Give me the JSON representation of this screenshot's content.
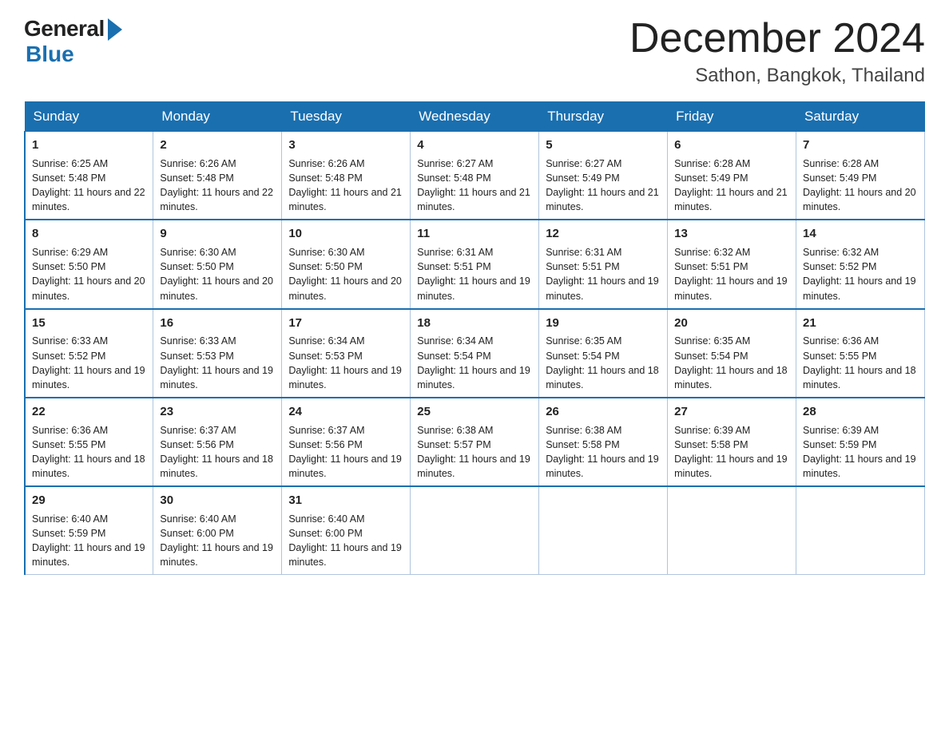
{
  "header": {
    "logo_general": "General",
    "logo_blue": "Blue",
    "title": "December 2024",
    "subtitle": "Sathon, Bangkok, Thailand"
  },
  "columns": [
    "Sunday",
    "Monday",
    "Tuesday",
    "Wednesday",
    "Thursday",
    "Friday",
    "Saturday"
  ],
  "weeks": [
    [
      {
        "day": "1",
        "sunrise": "Sunrise: 6:25 AM",
        "sunset": "Sunset: 5:48 PM",
        "daylight": "Daylight: 11 hours and 22 minutes."
      },
      {
        "day": "2",
        "sunrise": "Sunrise: 6:26 AM",
        "sunset": "Sunset: 5:48 PM",
        "daylight": "Daylight: 11 hours and 22 minutes."
      },
      {
        "day": "3",
        "sunrise": "Sunrise: 6:26 AM",
        "sunset": "Sunset: 5:48 PM",
        "daylight": "Daylight: 11 hours and 21 minutes."
      },
      {
        "day": "4",
        "sunrise": "Sunrise: 6:27 AM",
        "sunset": "Sunset: 5:48 PM",
        "daylight": "Daylight: 11 hours and 21 minutes."
      },
      {
        "day": "5",
        "sunrise": "Sunrise: 6:27 AM",
        "sunset": "Sunset: 5:49 PM",
        "daylight": "Daylight: 11 hours and 21 minutes."
      },
      {
        "day": "6",
        "sunrise": "Sunrise: 6:28 AM",
        "sunset": "Sunset: 5:49 PM",
        "daylight": "Daylight: 11 hours and 21 minutes."
      },
      {
        "day": "7",
        "sunrise": "Sunrise: 6:28 AM",
        "sunset": "Sunset: 5:49 PM",
        "daylight": "Daylight: 11 hours and 20 minutes."
      }
    ],
    [
      {
        "day": "8",
        "sunrise": "Sunrise: 6:29 AM",
        "sunset": "Sunset: 5:50 PM",
        "daylight": "Daylight: 11 hours and 20 minutes."
      },
      {
        "day": "9",
        "sunrise": "Sunrise: 6:30 AM",
        "sunset": "Sunset: 5:50 PM",
        "daylight": "Daylight: 11 hours and 20 minutes."
      },
      {
        "day": "10",
        "sunrise": "Sunrise: 6:30 AM",
        "sunset": "Sunset: 5:50 PM",
        "daylight": "Daylight: 11 hours and 20 minutes."
      },
      {
        "day": "11",
        "sunrise": "Sunrise: 6:31 AM",
        "sunset": "Sunset: 5:51 PM",
        "daylight": "Daylight: 11 hours and 19 minutes."
      },
      {
        "day": "12",
        "sunrise": "Sunrise: 6:31 AM",
        "sunset": "Sunset: 5:51 PM",
        "daylight": "Daylight: 11 hours and 19 minutes."
      },
      {
        "day": "13",
        "sunrise": "Sunrise: 6:32 AM",
        "sunset": "Sunset: 5:51 PM",
        "daylight": "Daylight: 11 hours and 19 minutes."
      },
      {
        "day": "14",
        "sunrise": "Sunrise: 6:32 AM",
        "sunset": "Sunset: 5:52 PM",
        "daylight": "Daylight: 11 hours and 19 minutes."
      }
    ],
    [
      {
        "day": "15",
        "sunrise": "Sunrise: 6:33 AM",
        "sunset": "Sunset: 5:52 PM",
        "daylight": "Daylight: 11 hours and 19 minutes."
      },
      {
        "day": "16",
        "sunrise": "Sunrise: 6:33 AM",
        "sunset": "Sunset: 5:53 PM",
        "daylight": "Daylight: 11 hours and 19 minutes."
      },
      {
        "day": "17",
        "sunrise": "Sunrise: 6:34 AM",
        "sunset": "Sunset: 5:53 PM",
        "daylight": "Daylight: 11 hours and 19 minutes."
      },
      {
        "day": "18",
        "sunrise": "Sunrise: 6:34 AM",
        "sunset": "Sunset: 5:54 PM",
        "daylight": "Daylight: 11 hours and 19 minutes."
      },
      {
        "day": "19",
        "sunrise": "Sunrise: 6:35 AM",
        "sunset": "Sunset: 5:54 PM",
        "daylight": "Daylight: 11 hours and 18 minutes."
      },
      {
        "day": "20",
        "sunrise": "Sunrise: 6:35 AM",
        "sunset": "Sunset: 5:54 PM",
        "daylight": "Daylight: 11 hours and 18 minutes."
      },
      {
        "day": "21",
        "sunrise": "Sunrise: 6:36 AM",
        "sunset": "Sunset: 5:55 PM",
        "daylight": "Daylight: 11 hours and 18 minutes."
      }
    ],
    [
      {
        "day": "22",
        "sunrise": "Sunrise: 6:36 AM",
        "sunset": "Sunset: 5:55 PM",
        "daylight": "Daylight: 11 hours and 18 minutes."
      },
      {
        "day": "23",
        "sunrise": "Sunrise: 6:37 AM",
        "sunset": "Sunset: 5:56 PM",
        "daylight": "Daylight: 11 hours and 18 minutes."
      },
      {
        "day": "24",
        "sunrise": "Sunrise: 6:37 AM",
        "sunset": "Sunset: 5:56 PM",
        "daylight": "Daylight: 11 hours and 19 minutes."
      },
      {
        "day": "25",
        "sunrise": "Sunrise: 6:38 AM",
        "sunset": "Sunset: 5:57 PM",
        "daylight": "Daylight: 11 hours and 19 minutes."
      },
      {
        "day": "26",
        "sunrise": "Sunrise: 6:38 AM",
        "sunset": "Sunset: 5:58 PM",
        "daylight": "Daylight: 11 hours and 19 minutes."
      },
      {
        "day": "27",
        "sunrise": "Sunrise: 6:39 AM",
        "sunset": "Sunset: 5:58 PM",
        "daylight": "Daylight: 11 hours and 19 minutes."
      },
      {
        "day": "28",
        "sunrise": "Sunrise: 6:39 AM",
        "sunset": "Sunset: 5:59 PM",
        "daylight": "Daylight: 11 hours and 19 minutes."
      }
    ],
    [
      {
        "day": "29",
        "sunrise": "Sunrise: 6:40 AM",
        "sunset": "Sunset: 5:59 PM",
        "daylight": "Daylight: 11 hours and 19 minutes."
      },
      {
        "day": "30",
        "sunrise": "Sunrise: 6:40 AM",
        "sunset": "Sunset: 6:00 PM",
        "daylight": "Daylight: 11 hours and 19 minutes."
      },
      {
        "day": "31",
        "sunrise": "Sunrise: 6:40 AM",
        "sunset": "Sunset: 6:00 PM",
        "daylight": "Daylight: 11 hours and 19 minutes."
      },
      null,
      null,
      null,
      null
    ]
  ]
}
